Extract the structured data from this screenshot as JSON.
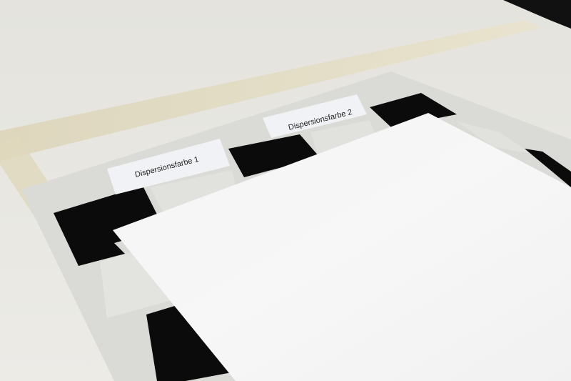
{
  "scene": {
    "kind": "photograph",
    "subject": "paint drawdown contrast test chart taped to a table"
  },
  "labels": {
    "left": "Dispersionsfarbe 1",
    "right": "Dispersionsfarbe 2"
  },
  "colors": {
    "background": "#e9e8e2",
    "tape": "#e4dcc1",
    "chart_base": "#dcdcd8",
    "black_patch": "#0b0b0b",
    "light_patch": "#e2e3df",
    "white_sheet": "#f6f6f6",
    "label_card": "#f2f3f6"
  }
}
